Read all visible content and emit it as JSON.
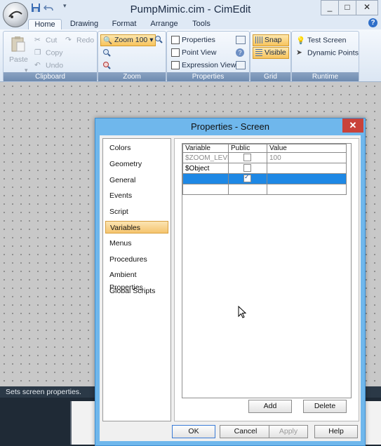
{
  "window": {
    "title": "PumpMimic.cim - CimEdit",
    "controls": [
      "_",
      "□",
      "✕"
    ]
  },
  "ribbon": {
    "tabs": [
      "Home",
      "Drawing",
      "Format",
      "Arrange",
      "Tools"
    ],
    "clipboard": {
      "paste": "Paste",
      "cut": "Cut",
      "copy": "Copy",
      "undo": "Undo",
      "redo": "Redo",
      "label": "Clipboard"
    },
    "zoom": {
      "value": "Zoom 100",
      "label": "Zoom"
    },
    "properties": {
      "properties": "Properties",
      "point_view": "Point View",
      "expression_view": "Expression View",
      "label": "Properties"
    },
    "grid": {
      "snap": "Snap",
      "visible": "Visible",
      "label": "Grid"
    },
    "runtime": {
      "test_screen": "Test Screen",
      "dynamic_points": "Dynamic Points",
      "label": "Runtime"
    }
  },
  "status": {
    "text": "Sets screen properties."
  },
  "dialog": {
    "title": "Properties - Screen",
    "categories": [
      "Colors",
      "Geometry",
      "General",
      "Events",
      "Script",
      "Variables",
      "Menus",
      "Procedures",
      "Ambient Properties",
      "Global Scripts"
    ],
    "selected_category": "Variables",
    "table": {
      "headers": [
        "Variable",
        "Public",
        "Value"
      ],
      "rows": [
        {
          "variable": "$ZOOM_LEVEL",
          "public": false,
          "value": "100"
        },
        {
          "variable": "$Object",
          "public": false,
          "value": ""
        },
        {
          "variable": "",
          "public": true,
          "value": ""
        },
        {
          "variable": "",
          "public": null,
          "value": ""
        }
      ]
    },
    "buttons": {
      "add": "Add",
      "delete": "Delete",
      "ok": "OK",
      "cancel": "Cancel",
      "apply": "Apply",
      "help": "Help"
    }
  },
  "colors": {
    "accent_selection": "#1e88e5",
    "dialog_frame": "#6fb7ec",
    "category_highlight": "#f5c46e",
    "close_red": "#c9423a"
  }
}
